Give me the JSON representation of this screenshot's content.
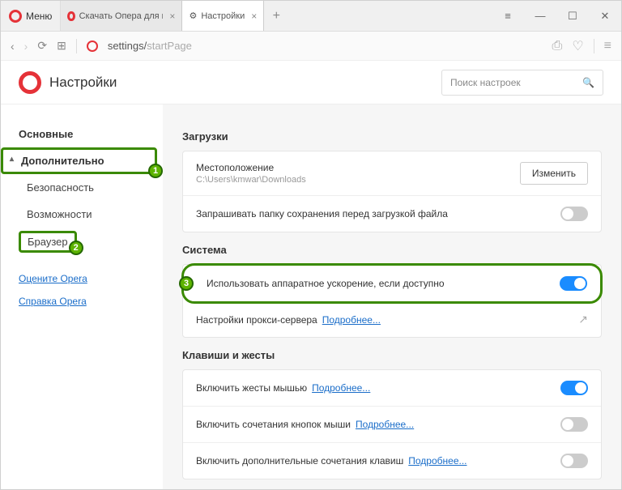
{
  "titlebar": {
    "menu": "Меню",
    "tab1": "Скачать Опера для комп...",
    "tab2": "Настройки",
    "win_list": "≡",
    "win_min": "—",
    "win_max": "☐",
    "win_close": "✕"
  },
  "addrbar": {
    "back": "‹",
    "fwd": "›",
    "reload": "⟳",
    "apps": "⊞",
    "url_main": "settings/",
    "url_sub": "startPage",
    "cam": "⎙",
    "heart": "♡",
    "ham": "≡"
  },
  "header": {
    "title": "Настройки",
    "search_placeholder": "Поиск настроек"
  },
  "sidebar": {
    "main": "Основные",
    "advanced": "Дополнительно",
    "security": "Безопасность",
    "features": "Возможности",
    "browser": "Браузер",
    "rate": "Оцените Opera",
    "help": "Справка Opera"
  },
  "annot": {
    "n1": "1",
    "n2": "2",
    "n3": "3"
  },
  "downloads": {
    "title": "Загрузки",
    "location_label": "Местоположение",
    "location_path": "C:\\Users\\kmwar\\Downloads",
    "change": "Изменить",
    "ask": "Запрашивать папку сохранения перед загрузкой файла"
  },
  "system": {
    "title": "Система",
    "hw": "Использовать аппаратное ускорение, если доступно",
    "proxy": "Настройки прокси-сервера",
    "proxy_more": "Подробнее..."
  },
  "gestures": {
    "title": "Клавиши и жесты",
    "mouse": "Включить жесты мышью",
    "more": "Подробнее...",
    "rocker": "Включить сочетания кнопок мыши",
    "extra_keys": "Включить дополнительные сочетания клавиш"
  }
}
